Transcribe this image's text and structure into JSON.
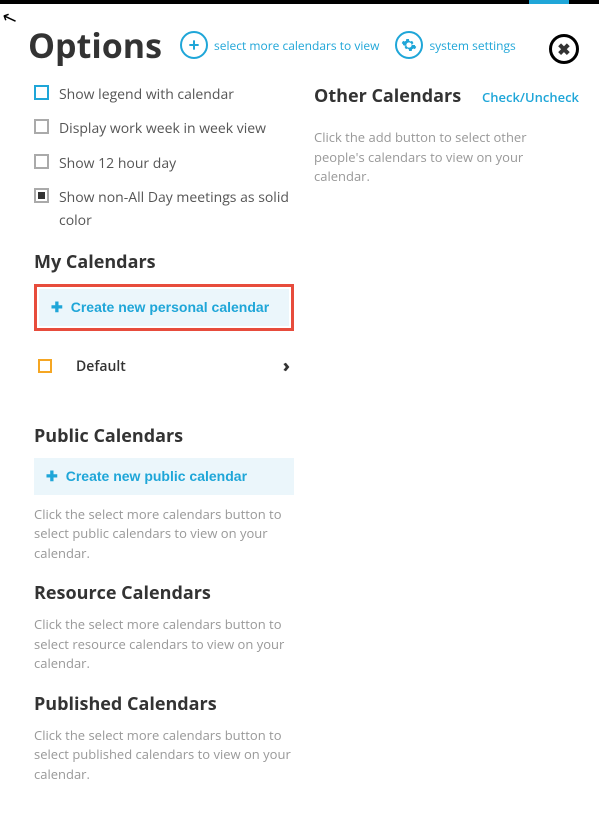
{
  "header": {
    "title": "Options",
    "select_more_label": "select more calendars to view",
    "system_settings_label": "system settings"
  },
  "options": {
    "legend": "Show legend with calendar",
    "work_week": "Display work week in week view",
    "twelve_hour": "Show 12 hour day",
    "solid_color": "Show non-All Day meetings as solid color"
  },
  "my_calendars": {
    "title": "My Calendars",
    "create_label": "Create new personal calendar",
    "default_label": "Default"
  },
  "public_calendars": {
    "title": "Public Calendars",
    "create_label": "Create new public calendar",
    "help": "Click the select more calendars button to select public calendars to view on your calendar."
  },
  "resource_calendars": {
    "title": "Resource Calendars",
    "help": "Click the select more calendars button to select resource calendars to view on your calendar."
  },
  "published_calendars": {
    "title": "Published Calendars",
    "help": "Click the select more calendars button to select published calendars to view on your calendar."
  },
  "other_calendars": {
    "title": "Other Calendars",
    "check_label": "Check/Uncheck",
    "help": "Click the add button to select other people's calendars to view on your calendar."
  }
}
